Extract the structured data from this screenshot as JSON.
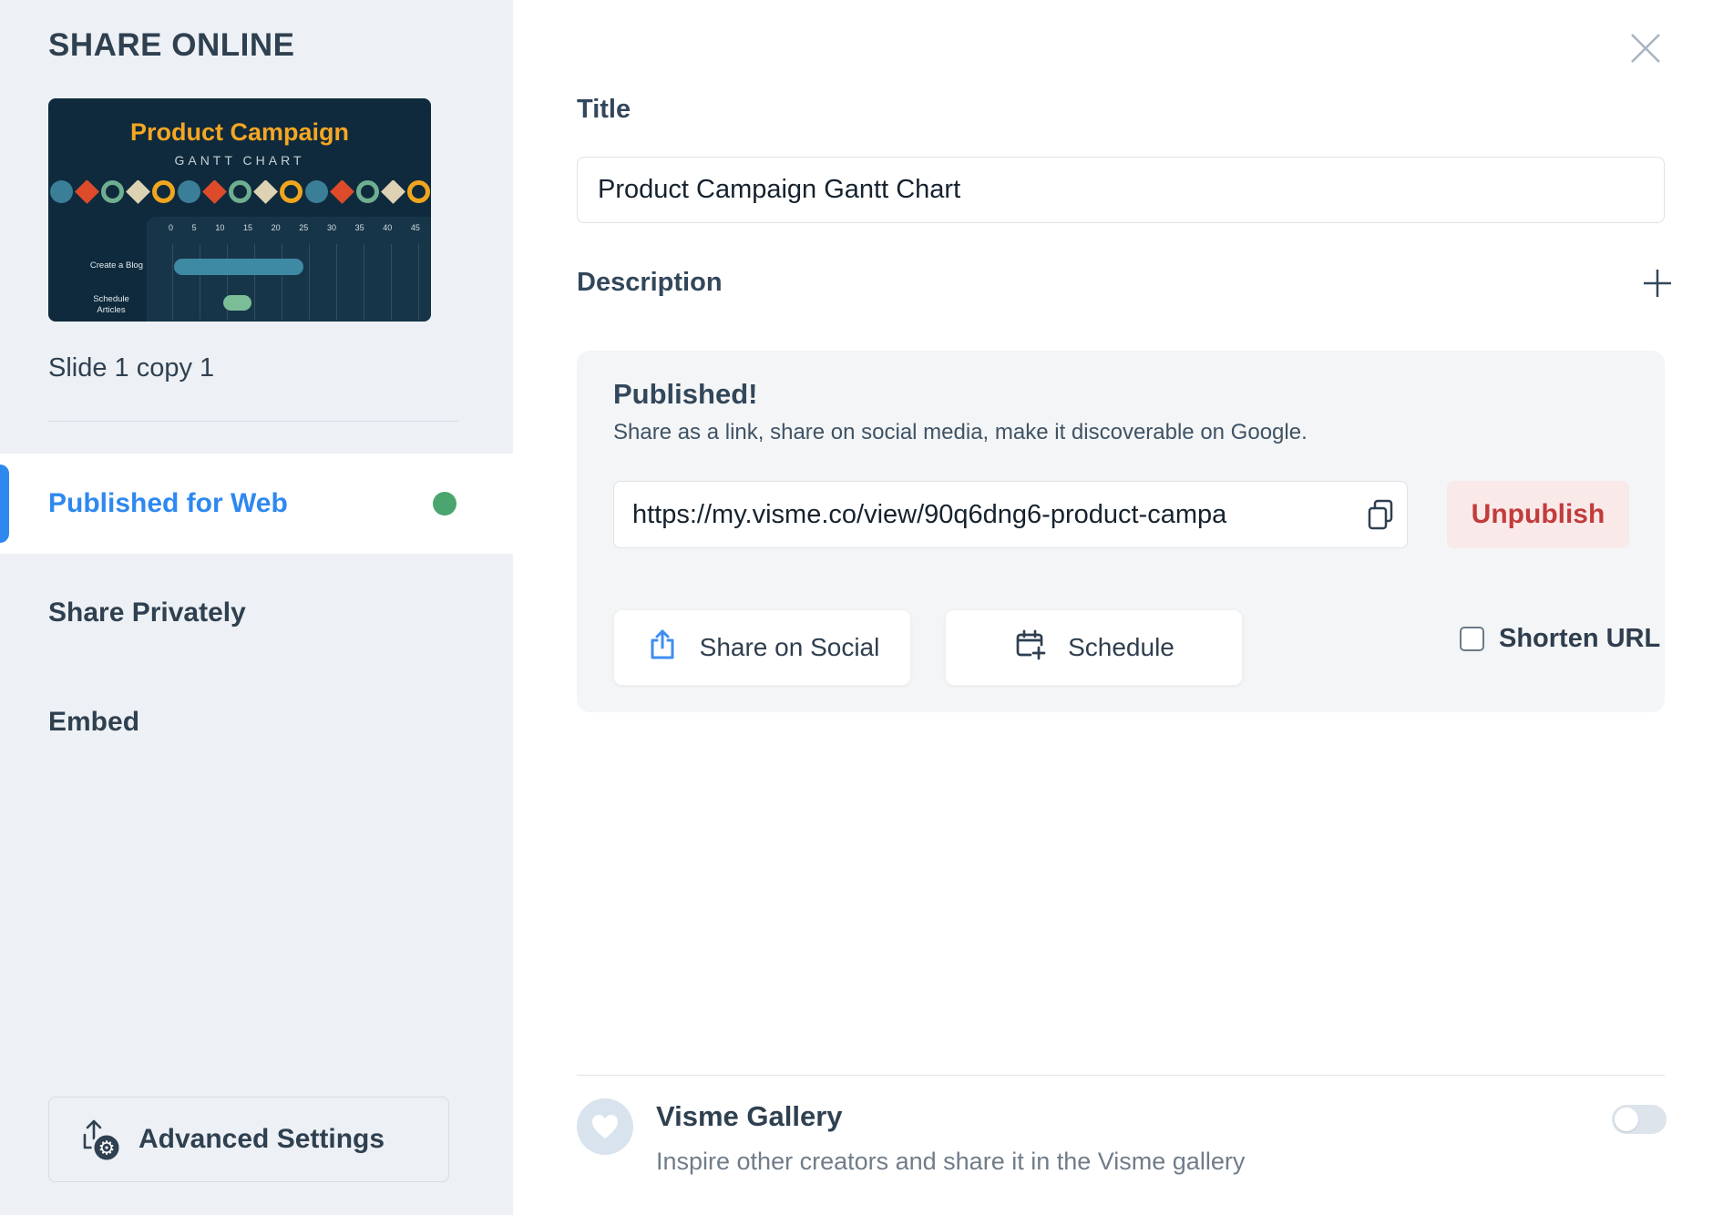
{
  "colors": {
    "accent_blue": "#2E88F0",
    "status_green": "#4AA56E",
    "danger_red": "#C23C3C",
    "danger_bg": "#FAE9E9",
    "sidebar_bg": "#EDF1F5",
    "panel_bg": "#F4F5F6",
    "slide_bg": "#0F2A3C",
    "slide_title_orange": "#F5A623"
  },
  "sidebar": {
    "title": "SHARE ONLINE",
    "slide_label": "Slide 1 copy 1",
    "thumbnail": {
      "title": "Product Campaign",
      "subtitle": "GANTT CHART",
      "axis_ticks": [
        "0",
        "5",
        "10",
        "15",
        "20",
        "25",
        "30",
        "35",
        "40",
        "45"
      ],
      "row_labels": [
        "Create a Blog",
        "Schedule Articles"
      ]
    },
    "nav": [
      {
        "label": "Published for Web"
      },
      {
        "label": "Share Privately"
      },
      {
        "label": "Embed"
      }
    ],
    "advanced_settings_label": "Advanced Settings"
  },
  "main": {
    "title_label": "Title",
    "title_value": "Product Campaign Gantt Chart",
    "description_label": "Description",
    "published": {
      "heading": "Published!",
      "subheading": "Share as a link, share on social media, make it discoverable on Google.",
      "url": "https://my.visme.co/view/90q6dng6-product-campa",
      "unpublish_label": "Unpublish",
      "share_on_social_label": "Share on Social",
      "schedule_label": "Schedule",
      "shorten_url_label": "Shorten URL"
    },
    "gallery": {
      "title": "Visme Gallery",
      "subtitle": "Inspire other creators and share it in the Visme gallery"
    }
  }
}
